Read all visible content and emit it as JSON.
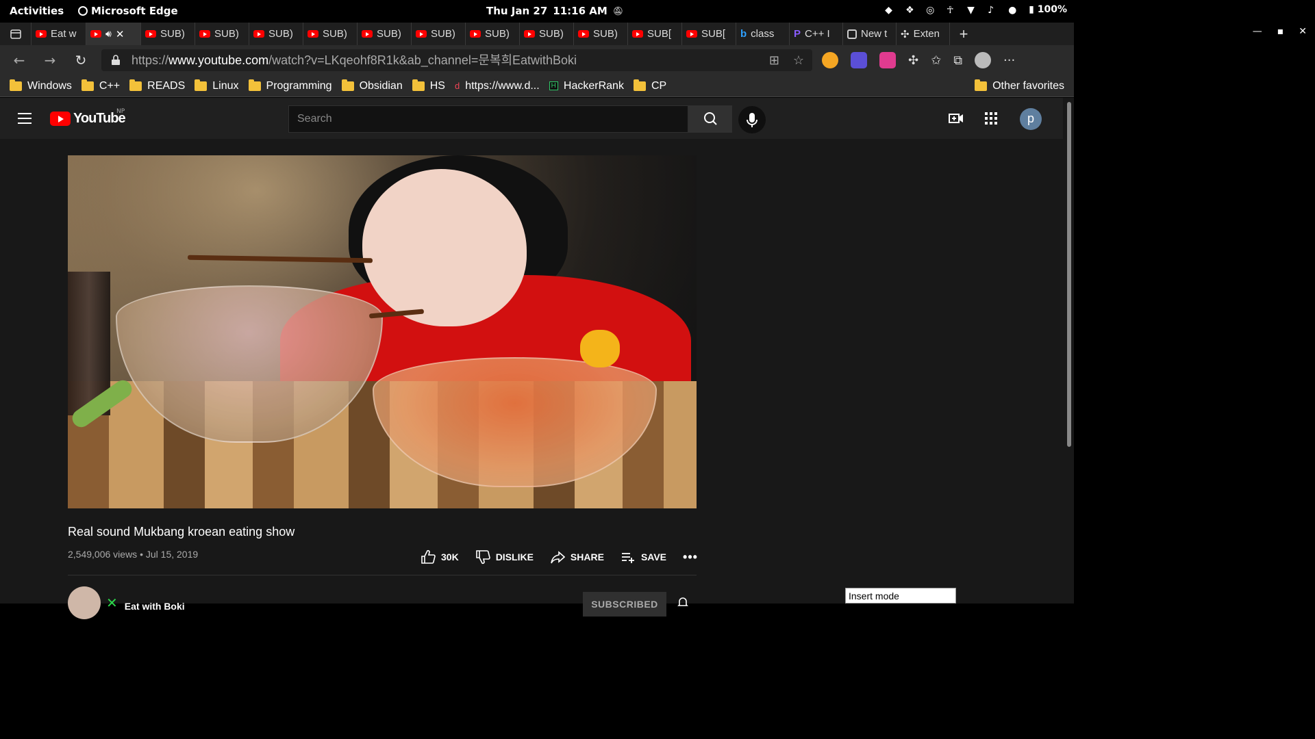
{
  "system_bar": {
    "activities": "Activities",
    "app_name": "Microsoft Edge",
    "date": "Thu Jan 27",
    "time": "11:16 AM",
    "battery": "100%"
  },
  "tabs": [
    {
      "label": "Eat w",
      "icon": "youtube-icon",
      "active": false
    },
    {
      "label": "",
      "icon": "youtube-icon",
      "active": true,
      "audio": true
    },
    {
      "label": "SUB)",
      "icon": "youtube-icon"
    },
    {
      "label": "SUB)",
      "icon": "youtube-icon"
    },
    {
      "label": "SUB)",
      "icon": "youtube-icon"
    },
    {
      "label": "SUB)",
      "icon": "youtube-icon"
    },
    {
      "label": "SUB)",
      "icon": "youtube-icon"
    },
    {
      "label": "SUB)",
      "icon": "youtube-icon"
    },
    {
      "label": "SUB)",
      "icon": "youtube-icon"
    },
    {
      "label": "SUB)",
      "icon": "youtube-icon"
    },
    {
      "label": "SUB)",
      "icon": "youtube-icon"
    },
    {
      "label": "SUB[",
      "icon": "youtube-icon"
    },
    {
      "label": "SUB[",
      "icon": "youtube-icon"
    },
    {
      "label": "class",
      "icon": "bing-icon"
    },
    {
      "label": "C++ I",
      "icon": "pen-icon"
    },
    {
      "label": "New t",
      "icon": "page-icon"
    },
    {
      "label": "Exten",
      "icon": "puzzle-icon"
    }
  ],
  "address_bar": {
    "url_prefix": "https://",
    "url_host": "www.youtube.com",
    "url_path": "/watch?v=LKqeohf8R1k&ab_channel=문복희EatwithBoki"
  },
  "bookmarks": [
    {
      "label": "Windows",
      "type": "folder"
    },
    {
      "label": "C++",
      "type": "folder"
    },
    {
      "label": "READS",
      "type": "folder"
    },
    {
      "label": "Linux",
      "type": "folder"
    },
    {
      "label": "Programming",
      "type": "folder"
    },
    {
      "label": "Obsidian",
      "type": "folder"
    },
    {
      "label": "HS",
      "type": "folder"
    },
    {
      "label": "https://www.d...",
      "type": "link"
    },
    {
      "label": "HackerRank",
      "type": "link"
    },
    {
      "label": "CP",
      "type": "folder"
    }
  ],
  "bookmarks_other": "Other favorites",
  "youtube": {
    "logo_text": "YouTube",
    "country_code": "NP",
    "search_placeholder": "Search",
    "avatar_letter": "p",
    "video_title": "Real sound Mukbang kroean eating show",
    "views": "2,549,006 views",
    "date": "Jul 15, 2019",
    "likes": "30K",
    "dislike_label": "DISLIKE",
    "share_label": "SHARE",
    "save_label": "SAVE",
    "channel_name": "Eat with Boki",
    "subscribe_label": "SUBSCRIBED"
  },
  "insert_mode": "Insert mode",
  "colors": {
    "yt_red": "#ff0000",
    "bg_dark": "#181818",
    "header": "#202020"
  }
}
